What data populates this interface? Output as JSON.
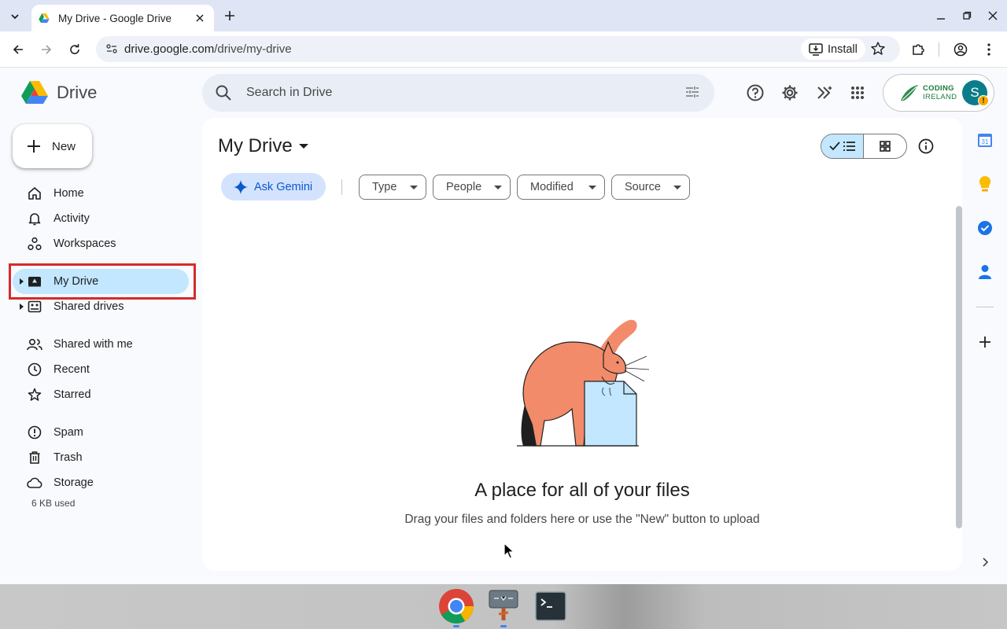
{
  "browser": {
    "tab_title": "My Drive - Google Drive",
    "url_host": "drive.google.com",
    "url_path": "/drive/my-drive",
    "install_label": "Install"
  },
  "app": {
    "name": "Drive",
    "search_placeholder": "Search in Drive",
    "new_label": "New",
    "account_initial": "S",
    "org_logo_line1": "CODING",
    "org_logo_line2": "IRELAND"
  },
  "sidebar": {
    "items": [
      {
        "label": "Home",
        "icon": "home-icon"
      },
      {
        "label": "Activity",
        "icon": "bell-icon"
      },
      {
        "label": "Workspaces",
        "icon": "workspaces-icon"
      },
      {
        "label": "My Drive",
        "icon": "my-drive-icon",
        "active": true
      },
      {
        "label": "Shared drives",
        "icon": "shared-drives-icon"
      },
      {
        "label": "Shared with me",
        "icon": "people-icon"
      },
      {
        "label": "Recent",
        "icon": "clock-icon"
      },
      {
        "label": "Starred",
        "icon": "star-icon"
      },
      {
        "label": "Spam",
        "icon": "spam-icon"
      },
      {
        "label": "Trash",
        "icon": "trash-icon"
      },
      {
        "label": "Storage",
        "icon": "cloud-icon"
      }
    ],
    "storage_used": "6 KB used"
  },
  "main": {
    "title": "My Drive",
    "gemini_label": "Ask Gemini",
    "filters": [
      "Type",
      "People",
      "Modified",
      "Source"
    ],
    "empty_title": "A place for all of your files",
    "empty_subtitle": "Drag your files and folders here or use the \"New\" button to upload"
  },
  "side_panel": {
    "calendar_day": "31"
  },
  "colors": {
    "active_nav": "#c2e7ff",
    "gemini_chip": "#d3e3fd",
    "highlight": "#d52b2b",
    "accent": "#0b57d0"
  }
}
